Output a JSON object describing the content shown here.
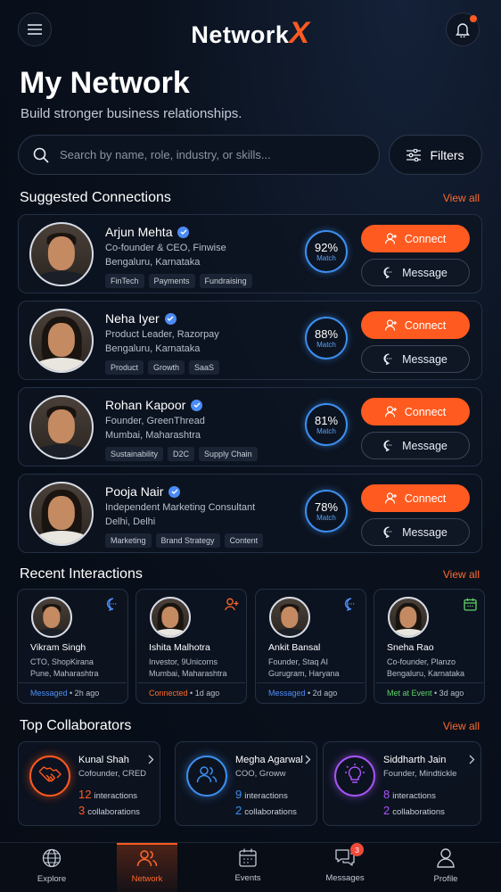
{
  "header": {
    "logo_main": "Network",
    "logo_accent": "X",
    "notification_dot": true
  },
  "page": {
    "title": "My Network",
    "subtitle": "Build stronger business relationships."
  },
  "search": {
    "placeholder": "Search by name, role, industry, or skills...",
    "filters_label": "Filters"
  },
  "suggested": {
    "title": "Suggested Connections",
    "view_all": "View all",
    "connect_label": "Connect",
    "message_label": "Message",
    "match_label": "Match",
    "items": [
      {
        "name": "Arjun Mehta",
        "role": "Co-founder & CEO, Finwise",
        "location": "Bengaluru, Karnataka",
        "tags": [
          "FinTech",
          "Payments",
          "Fundraising"
        ],
        "match": "92%"
      },
      {
        "name": "Neha Iyer",
        "role": "Product Leader, Razorpay",
        "location": "Bengaluru, Karnataka",
        "tags": [
          "Product",
          "Growth",
          "SaaS"
        ],
        "match": "88%"
      },
      {
        "name": "Rohan Kapoor",
        "role": "Founder, GreenThread",
        "location": "Mumbai, Maharashtra",
        "tags": [
          "Sustainability",
          "D2C",
          "Supply Chain"
        ],
        "match": "81%"
      },
      {
        "name": "Pooja Nair",
        "role": "Independent Marketing Consultant",
        "location": "Delhi, Delhi",
        "tags": [
          "Marketing",
          "Brand Strategy",
          "Content"
        ],
        "match": "78%"
      }
    ]
  },
  "recent": {
    "title": "Recent Interactions",
    "view_all": "View all",
    "items": [
      {
        "name": "Vikram Singh",
        "role": "CTO, ShopKirana",
        "location": "Pune, Maharashtra",
        "status": "Messaged",
        "time": "• 2h ago",
        "status_color": "#4f8ef7",
        "icon": "chat-bubble-icon"
      },
      {
        "name": "Ishita Malhotra",
        "role": "Investor, 9Unicorns",
        "location": "Mumbai, Maharashtra",
        "status": "Connected",
        "time": "• 1d ago",
        "status_color": "#ff6a2b",
        "icon": "user-add-icon"
      },
      {
        "name": "Ankit Bansal",
        "role": "Founder, Staq AI",
        "location": "Gurugram, Haryana",
        "status": "Messaged",
        "time": "• 2d ago",
        "status_color": "#4f8ef7",
        "icon": "chat-bubble-icon"
      },
      {
        "name": "Sneha Rao",
        "role": "Co-founder, Planzo",
        "location": "Bengaluru, Karnataka",
        "status": "Met at Event",
        "time": "• 3d ago",
        "status_color": "#5fd36a",
        "icon": "calendar-icon"
      }
    ]
  },
  "collaborators": {
    "title": "Top Collaborators",
    "view_all": "View all",
    "interactions_label": "interactions",
    "collaborations_label": "collaborations",
    "items": [
      {
        "name": "Kunal Shah",
        "role": "Cofounder, CRED",
        "interactions": "12",
        "collaborations": "3",
        "color": "#ff5a1f",
        "icon": "handshake-icon"
      },
      {
        "name": "Megha Agarwal",
        "role": "COO, Groww",
        "interactions": "9",
        "collaborations": "2",
        "color": "#3d8ff0",
        "icon": "users-icon"
      },
      {
        "name": "Siddharth Jain",
        "role": "Founder, Mindtickle",
        "interactions": "8",
        "collaborations": "2",
        "color": "#a855f7",
        "icon": "lightbulb-icon"
      }
    ]
  },
  "nav": {
    "items": [
      {
        "label": "Explore",
        "icon": "globe-icon"
      },
      {
        "label": "Network",
        "icon": "users-icon",
        "active": true
      },
      {
        "label": "Events",
        "icon": "calendar-icon"
      },
      {
        "label": "Messages",
        "icon": "chat-icon",
        "badge": "3"
      },
      {
        "label": "Profile",
        "icon": "user-icon"
      }
    ]
  },
  "colors": {
    "accent": "#ff5a1f",
    "blue": "#3d8ff0",
    "background": "#0a111d"
  }
}
